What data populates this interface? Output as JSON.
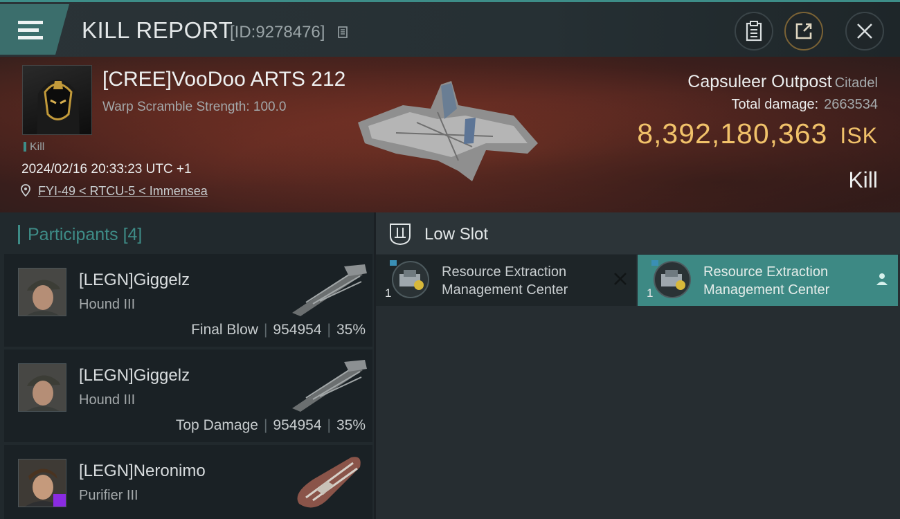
{
  "header": {
    "title": "KILL REPORT",
    "report_id": "[ID:9278476]"
  },
  "victim": {
    "name": "[CREE]VooDoo ARTS 212",
    "subtitle": "Warp Scramble Strength: 100.0",
    "tag": "Kill",
    "datetime": "2024/02/16 20:33:23 UTC +1",
    "location": "FYI-49 < RTCU-5 < Immensea"
  },
  "target": {
    "name": "Capsuleer Outpost",
    "class": "Citadel",
    "total_damage_label": "Total damage:",
    "total_damage": "2663534",
    "isk_value": "8,392,180,363",
    "isk_unit": "ISK",
    "result": "Kill"
  },
  "participants": {
    "label": "Participants",
    "count": "[4]",
    "items": [
      {
        "name": "[LEGN]Giggelz",
        "ship": "Hound III",
        "role": "Final Blow",
        "damage": "954954",
        "percent": "35%"
      },
      {
        "name": "[LEGN]Giggelz",
        "ship": "Hound III",
        "role": "Top Damage",
        "damage": "954954",
        "percent": "35%"
      },
      {
        "name": "[LEGN]Neronimo",
        "ship": "Purifier III"
      }
    ]
  },
  "slots": {
    "title": "Low Slot",
    "modules": [
      {
        "name_line1": "Resource Extraction",
        "name_line2": "Management Center",
        "qty": "1",
        "state": "destroyed"
      },
      {
        "name_line1": "Resource Extraction",
        "name_line2": "Management Center",
        "qty": "1",
        "state": "dropped"
      }
    ]
  },
  "colors": {
    "accent": "#3d8d88",
    "isk": "#f1c26a",
    "banner": "#5e2a22"
  },
  "icons": [
    "menu-icon",
    "copy-icon",
    "clipboard-icon",
    "share-icon",
    "close-icon",
    "location-pin-icon",
    "low-slot-icon",
    "destroyed-x-icon",
    "person-icon"
  ]
}
